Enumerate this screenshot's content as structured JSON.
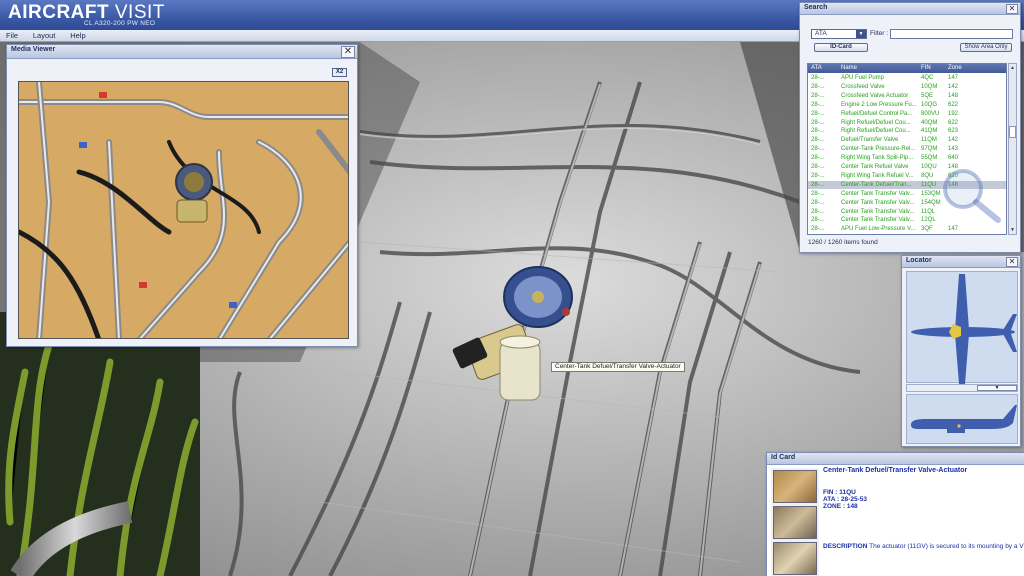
{
  "app": {
    "title_bold": "AIRCRAFT",
    "title_light": " VISIT",
    "subtitle": "CL A320-200 PW NEO"
  },
  "menu": {
    "items": [
      "File",
      "Layout",
      "Help"
    ]
  },
  "media_viewer": {
    "title": "Media Viewer",
    "close": "✕",
    "zoom_button": "X2"
  },
  "search": {
    "title": "Search",
    "close": "✕",
    "mode_select": "ATA",
    "filter_label": "Filter :",
    "filter_value": "",
    "idcard_button": "ID-Card",
    "show_area_button": "Show Area Only",
    "columns": [
      "ATA",
      "Name",
      "FIN",
      "Zone"
    ],
    "rows": [
      {
        "ata": "28-...",
        "name": "APU Fuel Pump",
        "fin": "4QC",
        "zone": "147"
      },
      {
        "ata": "28-...",
        "name": "Crossfeed Valve",
        "fin": "10QM",
        "zone": "142"
      },
      {
        "ata": "28-...",
        "name": "Crossfeed Valve Actuator",
        "fin": "5QE",
        "zone": "148"
      },
      {
        "ata": "28-...",
        "name": "Engine 2 Low Pressure Fu...",
        "fin": "10QG",
        "zone": "622"
      },
      {
        "ata": "28-...",
        "name": "Refuel/Defuel Control Pa...",
        "fin": "800VU",
        "zone": "192"
      },
      {
        "ata": "28-...",
        "name": "Right Refuel/Defuel Cou...",
        "fin": "40QM",
        "zone": "622"
      },
      {
        "ata": "28-...",
        "name": "Right Refuel/Defuel Cou...",
        "fin": "41QM",
        "zone": "623"
      },
      {
        "ata": "28-...",
        "name": "Defuel/Transfer Valve",
        "fin": "11QM",
        "zone": "142"
      },
      {
        "ata": "28-...",
        "name": "Center-Tank Pressure-Rel...",
        "fin": "97QM",
        "zone": "143"
      },
      {
        "ata": "28-...",
        "name": "Right Wing Tank Spill-Pip...",
        "fin": "55QM",
        "zone": "640"
      },
      {
        "ata": "28-...",
        "name": "Center Tank Refuel Valve",
        "fin": "10QU",
        "zone": "148"
      },
      {
        "ata": "28-...",
        "name": "Right Wing Tank Refuel V...",
        "fin": "8QU",
        "zone": "620"
      },
      {
        "ata": "28-...",
        "name": "Center-Tank Defuel/Tran...",
        "fin": "11QU",
        "zone": "148"
      },
      {
        "ata": "28-...",
        "name": "Center Tank Transfer Valv...",
        "fin": "153QM",
        "zone": ""
      },
      {
        "ata": "28-...",
        "name": "Center Tank Transfer Valv...",
        "fin": "154QM",
        "zone": ""
      },
      {
        "ata": "28-...",
        "name": "Center Tank Transfer Valv...",
        "fin": "11QL",
        "zone": ""
      },
      {
        "ata": "28-...",
        "name": "Center Tank Transfer Valv...",
        "fin": "12QL",
        "zone": ""
      },
      {
        "ata": "28-...",
        "name": "APU Fuel Low-Pressure V...",
        "fin": "3QF",
        "zone": "147"
      }
    ],
    "selected_index": 12,
    "result_count": "1260 / 1260 items found"
  },
  "locator": {
    "title": "Locator",
    "close": "✕"
  },
  "idcard": {
    "title": "Id Card",
    "component_name": "Center-Tank Defuel/Transfer Valve-Actuator",
    "fin": "FIN : 11QU",
    "ata": "ATA : 28-25-53",
    "zone": "ZONE : 148",
    "description_label": "DESCRIPTION",
    "description_text": " The actuator (11GV) is secured to its mounting by a V"
  },
  "tooltip": {
    "text": "Center-Tank Defuel/Transfer Valve-Actuator"
  },
  "colors": {
    "title_bar": "#3b5aa6",
    "result_text": "#27a11f",
    "id_text": "#1a2fa8",
    "aircraft_blue": "#3f5fae"
  }
}
